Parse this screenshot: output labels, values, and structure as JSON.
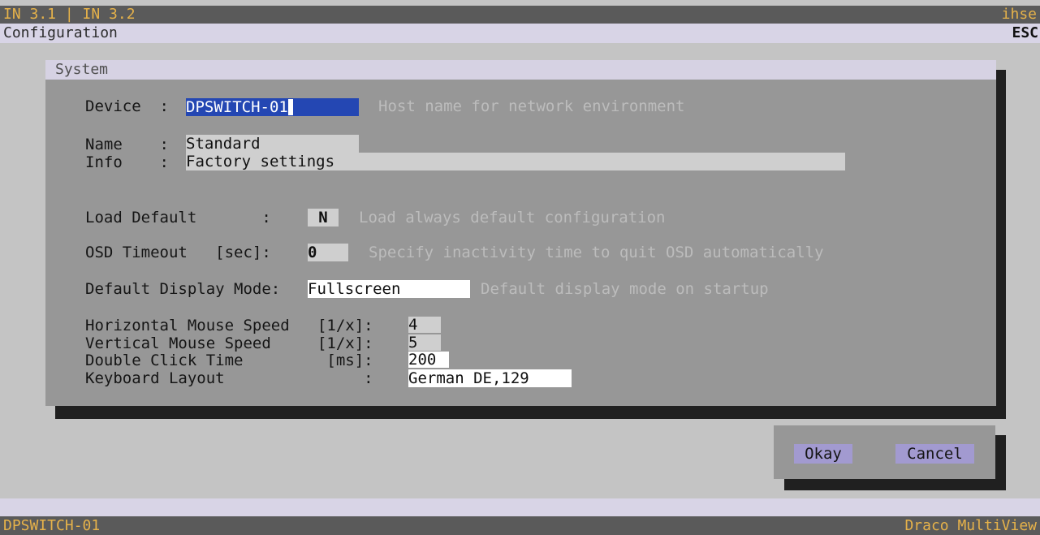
{
  "header": {
    "inputs": "IN 3.1 | IN 3.2",
    "brand": "ihse"
  },
  "menu": {
    "title": "Configuration",
    "esc_label": "ESC"
  },
  "panel": {
    "title": "System",
    "device": {
      "label": "Device  :",
      "value": "DPSWITCH-01",
      "hint": "Host name for network environment"
    },
    "name": {
      "label": "Name    :",
      "value": "Standard"
    },
    "info": {
      "label": "Info    :",
      "value": "Factory settings"
    },
    "load_default": {
      "label": "Load Default       :",
      "value": "N",
      "hint": "Load always default configuration"
    },
    "osd_timeout": {
      "label": "OSD Timeout   [sec]:",
      "value": "0",
      "hint": "Specify inactivity time to quit OSD automatically"
    },
    "display_mode": {
      "label": "Default Display Mode:",
      "value": "Fullscreen",
      "hint": "Default display mode on startup"
    },
    "h_mouse": {
      "label": "Horizontal Mouse Speed   [1/x]:",
      "value": "4"
    },
    "v_mouse": {
      "label": "Vertical Mouse Speed     [1/x]:",
      "value": "5"
    },
    "dbl_click": {
      "label": "Double Click Time         [ms]:",
      "value": "200"
    },
    "keyboard": {
      "label": "Keyboard Layout               :",
      "value": "German DE,129"
    }
  },
  "buttons": {
    "okay": "Okay",
    "cancel": "Cancel"
  },
  "footer": {
    "device": "DPSWITCH-01",
    "product": "Draco MultiView"
  },
  "colors": {
    "accent_text": "#e6b24a",
    "selection": "#2447b3",
    "button": "#a29ad0"
  }
}
